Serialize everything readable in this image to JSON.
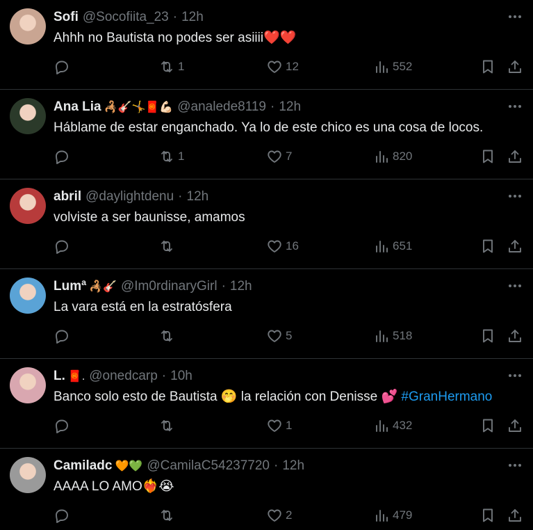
{
  "tweets": [
    {
      "name": "Sofi",
      "name_emoji": "",
      "handle": "@Socofiita_23",
      "time": "12h",
      "text": "Ahhh no Bautista no podes ser asiiii❤️❤️",
      "replies": "",
      "retweets": "1",
      "likes": "12",
      "views": "552",
      "avatar_color": "#c9a592"
    },
    {
      "name": "Ana Lia",
      "name_emoji": "🦂🎸🤸🧧💪🏻",
      "handle": "@analede8119",
      "time": "12h",
      "text": "Háblame de estar enganchado. Ya lo de este chico es una cosa de locos.",
      "replies": "",
      "retweets": "1",
      "likes": "7",
      "views": "820",
      "avatar_color": "#2b3a2a"
    },
    {
      "name": "abril",
      "name_emoji": "",
      "handle": "@daylightdenu",
      "time": "12h",
      "text": "volviste a ser baunisse, amamos",
      "replies": "",
      "retweets": "",
      "likes": "16",
      "views": "651",
      "avatar_color": "#b73b3b"
    },
    {
      "name": "Lumª",
      "name_emoji": "🦂🎸",
      "handle": "@Im0rdinaryGirl",
      "time": "12h",
      "text": "La vara está en la estratósfera",
      "replies": "",
      "retweets": "",
      "likes": "5",
      "views": "518",
      "avatar_color": "#5aa3d6"
    },
    {
      "name": "L.",
      "name_emoji": "🧧.",
      "handle": "@onedcarp",
      "time": "10h",
      "text": "Banco solo esto de Bautista 🤭 la relación con Denisse 💕",
      "hashtag": "#GranHermano",
      "replies": "",
      "retweets": "",
      "likes": "1",
      "views": "432",
      "avatar_color": "#d9a7b0"
    },
    {
      "name": "Camiladc",
      "name_emoji": "🧡💚",
      "handle": "@CamilaC54237720",
      "time": "12h",
      "text": "AAAA LO AMO❤️‍🔥😭",
      "replies": "",
      "retweets": "",
      "likes": "2",
      "views": "479",
      "avatar_color": "#9a9a9a"
    }
  ],
  "icons": {
    "reply": "reply-icon",
    "retweet": "retweet-icon",
    "like": "heart-icon",
    "views": "views-icon",
    "bookmark": "bookmark-icon",
    "share": "share-icon",
    "more": "more-icon"
  },
  "colors": {
    "background": "#000000",
    "text": "#e7e9ea",
    "muted": "#71767b",
    "link": "#1d9bf0",
    "divider": "#2f3336"
  }
}
